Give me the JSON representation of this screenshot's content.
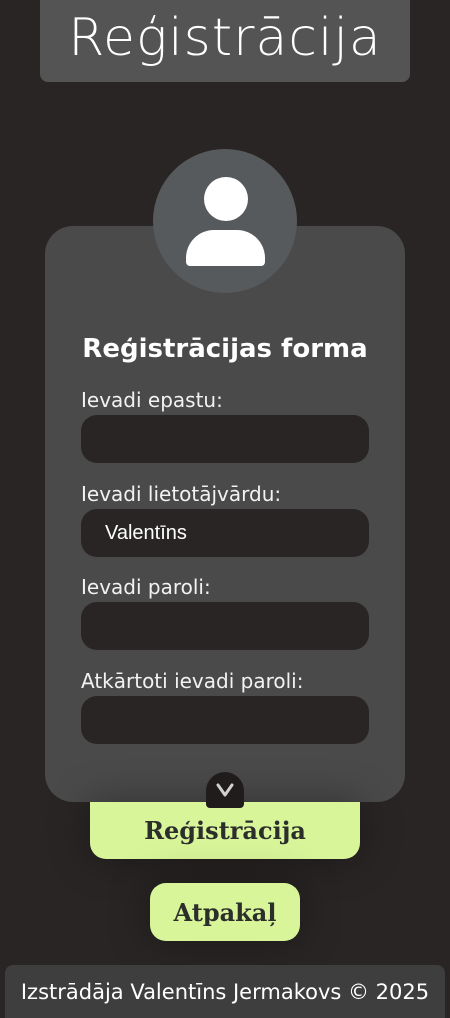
{
  "header": {
    "title": "Reģistrācija"
  },
  "form": {
    "title": "Reģistrācijas forma",
    "fields": [
      {
        "label": "Ievadi epastu:",
        "value": "",
        "placeholder": ""
      },
      {
        "label": "Ievadi lietotājvārdu:",
        "value": "Valentīns",
        "placeholder": ""
      },
      {
        "label": "Ievadi paroli:",
        "value": "",
        "placeholder": ""
      },
      {
        "label": "Atkārtoti ievadi paroli:",
        "value": "",
        "placeholder": ""
      }
    ],
    "toggle_icon": "chevron-down-icon"
  },
  "buttons": {
    "register": "Reģistrācija",
    "back": "Atpakaļ"
  },
  "footer": {
    "text": "Izstrādāja Valentīns Jermakovs © 2025"
  },
  "colors": {
    "background": "#292524",
    "card": "#4a4a4a",
    "accent": "#d9f59a",
    "header": "#545454"
  }
}
